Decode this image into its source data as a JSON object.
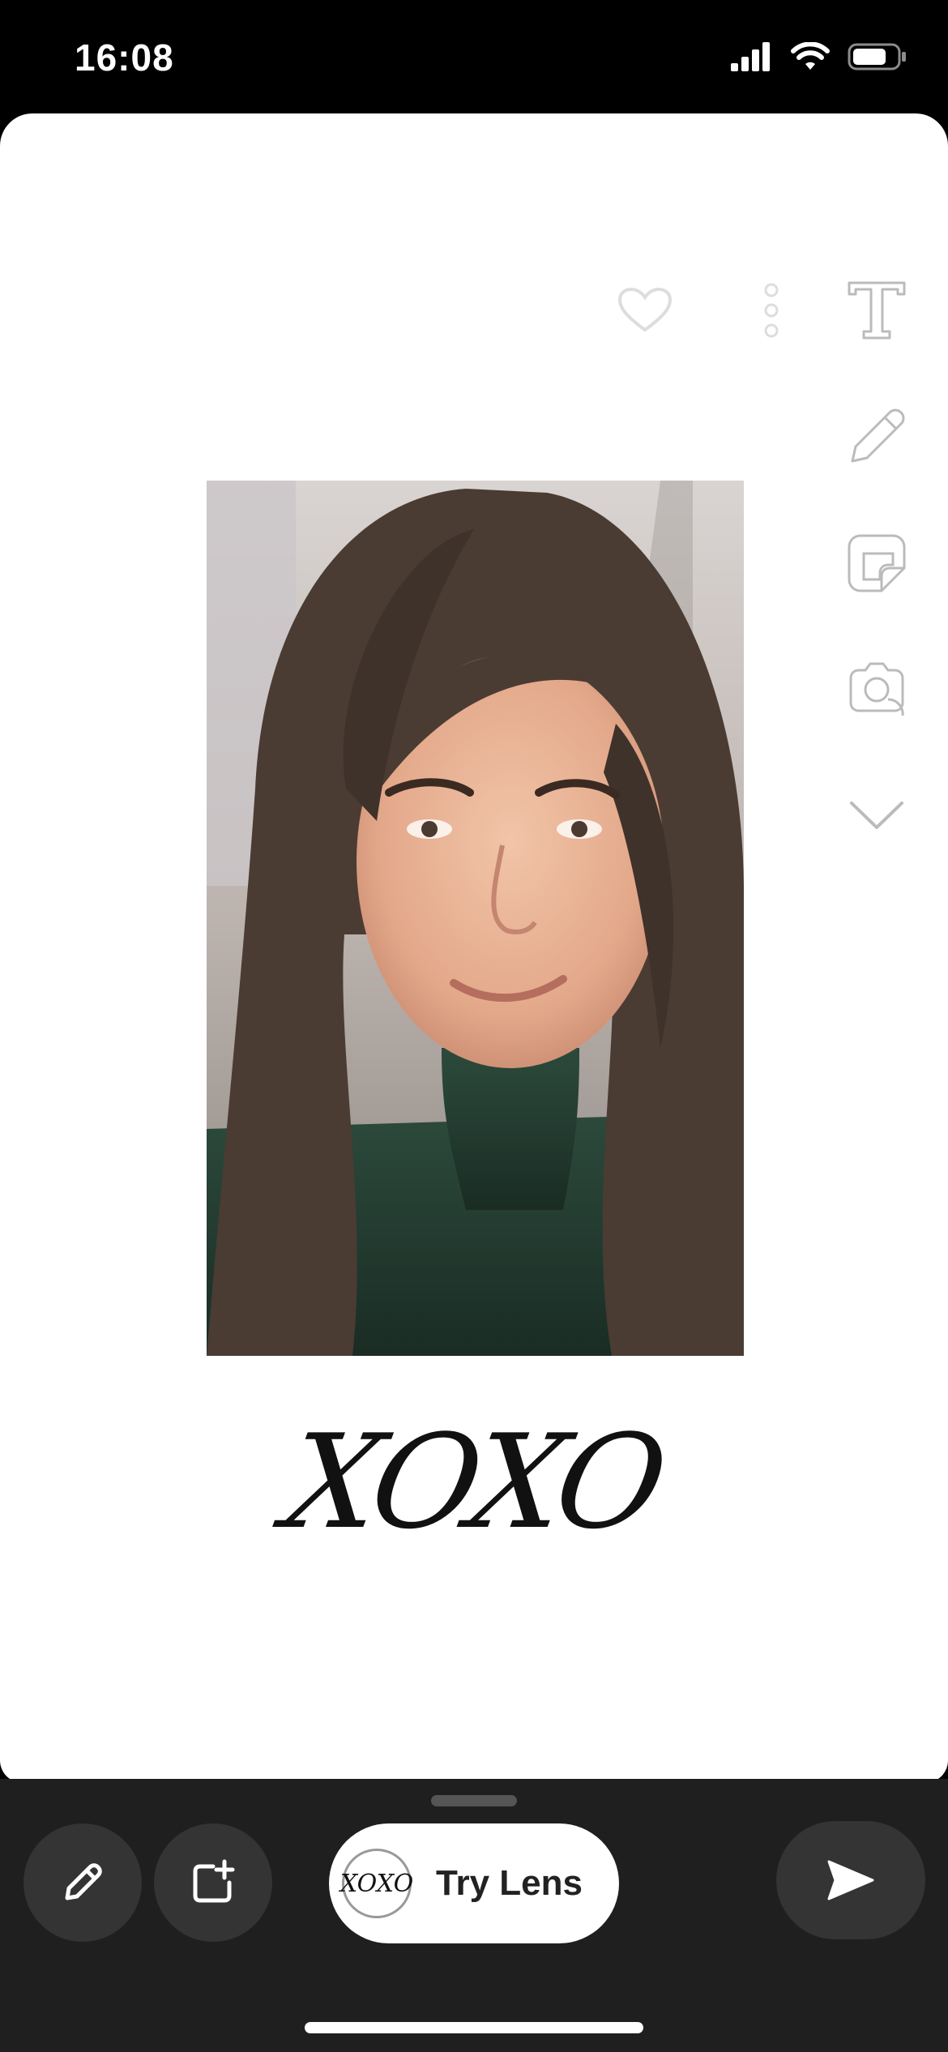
{
  "status_bar": {
    "time": "16:08"
  },
  "toolbar": {
    "icons": [
      "heart-icon",
      "more-dots-icon"
    ]
  },
  "side_tools": {
    "icons": [
      "text-icon",
      "pencil-icon",
      "sticker-icon",
      "camera-lens-icon",
      "chevron-down-icon"
    ]
  },
  "snap": {
    "caption": "XOXO"
  },
  "bottom_bar": {
    "try_lens_label": "Try Lens",
    "lens_thumb_text": "XOXO"
  },
  "colors": {
    "background": "#000000",
    "card": "#ffffff",
    "bottom_bar": "#1f1f1f",
    "button": "#343434"
  }
}
